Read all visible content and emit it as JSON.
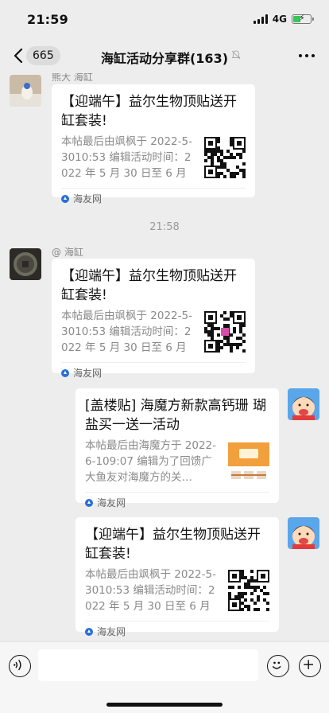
{
  "status": {
    "time": "21:59",
    "network": "4G"
  },
  "nav": {
    "back_count": "665",
    "title": "海缸活动分享群(163)"
  },
  "messages": [
    {
      "sender": "熊大 海缸",
      "title": "【迎端午】益尔生物顶贴送开缸套装!",
      "desc": "本帖最后由飒枫于 2022-5-3010:53 编辑活动时间：2022 年 5 月 30 日至 6 月 …",
      "source": "海友网"
    },
    {
      "sender": "@ 海缸",
      "title": "【迎端午】益尔生物顶贴送开缸套装!",
      "desc": "本帖最后由飒枫于 2022-5-3010:53 编辑活动时间：2022 年 5 月 30 日至 6 月 …",
      "source": "海友网"
    },
    {
      "sender": "",
      "title": "[盖楼贴] 海魔方新款高钙珊 瑚盐买一送一活动",
      "desc": "本帖最后由海魔方于 2022-6-109:07 编辑为了回馈广大鱼友对海魔方的关…",
      "source": "海友网"
    },
    {
      "sender": "",
      "title": "【迎端午】益尔生物顶贴送开缸套装!",
      "desc": "本帖最后由飒枫于 2022-5-3010:53 编辑活动时间：2022 年 5 月 30 日至 6 月 …",
      "source": "海友网"
    }
  ],
  "timestamp": "21:58",
  "input": {
    "value": ""
  }
}
